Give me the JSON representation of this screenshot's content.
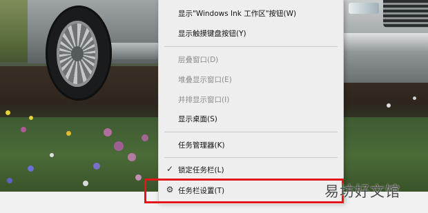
{
  "context_menu": {
    "items": [
      {
        "label": "显示\"Windows Ink 工作区\"按钮(W)",
        "enabled": true,
        "icon": ""
      },
      {
        "label": "显示触摸键盘按钮(Y)",
        "enabled": true,
        "icon": ""
      },
      {
        "label": "层叠窗口(D)",
        "enabled": false,
        "icon": ""
      },
      {
        "label": "堆叠显示窗口(E)",
        "enabled": false,
        "icon": ""
      },
      {
        "label": "并排显示窗口(I)",
        "enabled": false,
        "icon": ""
      },
      {
        "label": "显示桌面(S)",
        "enabled": true,
        "icon": ""
      },
      {
        "label": "任务管理器(K)",
        "enabled": true,
        "icon": ""
      },
      {
        "label": "锁定任务栏(L)",
        "enabled": true,
        "icon": "checkmark-icon",
        "checked": true
      },
      {
        "label": "任务栏设置(T)",
        "enabled": true,
        "icon": "gear-icon",
        "highlighted": true
      }
    ]
  },
  "icons": {
    "check_glyph": "✓",
    "gear_glyph": "⚙"
  },
  "watermark": "易坊好文馆",
  "colors": {
    "menu_background": "#eeeeee",
    "disabled_text": "#8c8c8c",
    "highlight_border": "#e5141b",
    "taskbar": "#f0f0f0"
  }
}
